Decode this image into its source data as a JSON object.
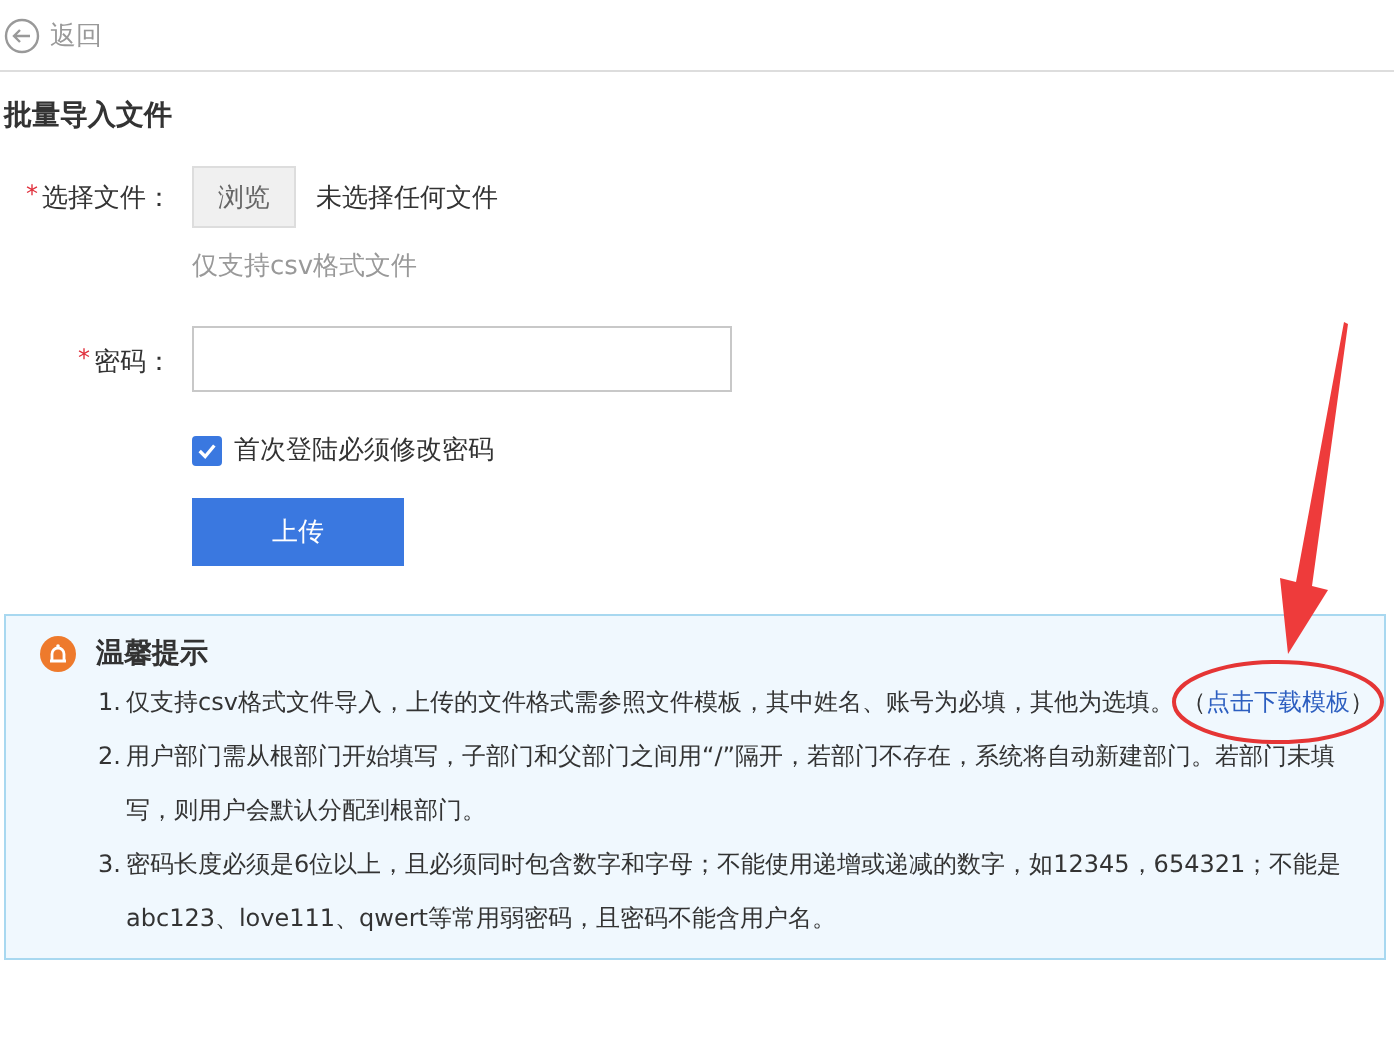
{
  "back": {
    "label": "返回"
  },
  "title": "批量导入文件",
  "file_field": {
    "label": "选择文件：",
    "required": true,
    "required_mark": "*",
    "button": "浏览",
    "status": "未选择任何文件",
    "hint": "仅支持csv格式文件"
  },
  "password_field": {
    "label": "密码：",
    "required": true,
    "required_mark": "*"
  },
  "force_change": {
    "label": "首次登陆必须修改密码",
    "checked": true
  },
  "submit": "上传",
  "tips": {
    "title": "温馨提示",
    "items": [
      {
        "number": "1.",
        "text": "仅支持csv格式文件导入，上传的文件格式需参照文件模板，其中姓名、账号为必填，其他为选填。",
        "before": "（",
        "link": "点击下载模板",
        "after": "）"
      },
      {
        "number": "2.",
        "text": "用户部门需从根部门开始填写，子部门和父部门之间用“/”隔开，若部门不存在，系统将自动新建部门。若部门未填写，则用户会默认分配到根部门。"
      },
      {
        "number": "3.",
        "text": "密码长度必须是6位以上，且必须同时包含数字和字母；不能使用递增或递减的数字，如12345，654321；不能是abc123、love111、qwert等常用弱密码，且密码不能含用户名。"
      }
    ]
  }
}
